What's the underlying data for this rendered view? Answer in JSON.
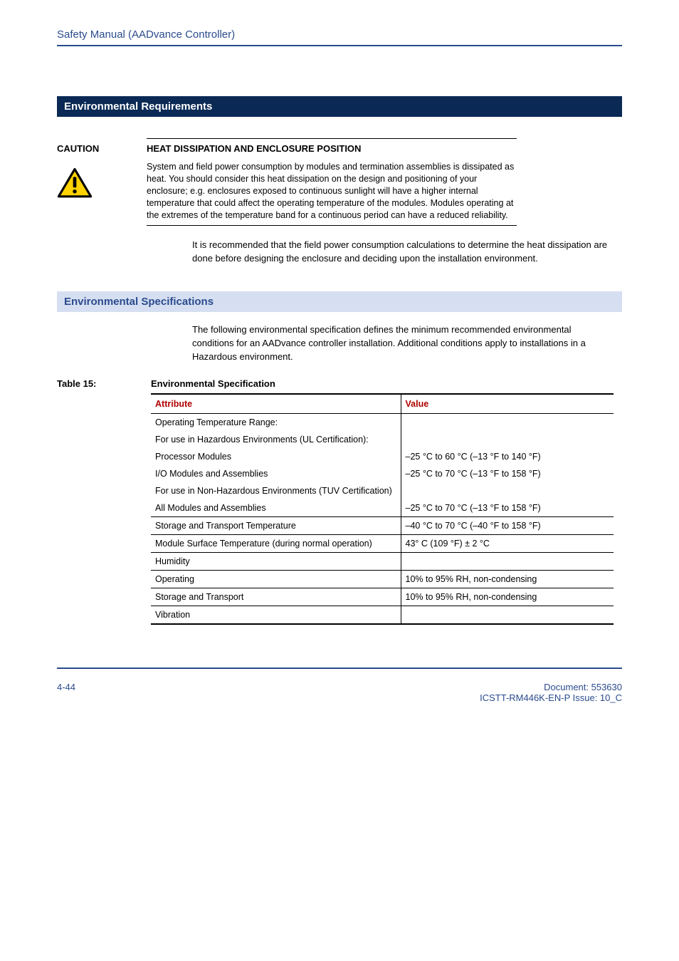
{
  "header": {
    "title": "Safety Manual (AADvance Controller)"
  },
  "sections": {
    "env_req_heading": "Environmental Requirements",
    "env_spec_heading": "Environmental Specifications"
  },
  "caution": {
    "label": "CAUTION",
    "heading": "HEAT DISSIPATION AND ENCLOSURE POSITION",
    "body": "System and field power consumption by modules and termination assemblies is dissipated as heat. You should consider this heat dissipation on the design and positioning of your enclosure; e.g. enclosures exposed to continuous sunlight will have a higher internal temperature that could affect the operating temperature of the modules.  Modules operating at the extremes of the temperature band for a continuous period can have a reduced reliability.",
    "icon_name": "caution-triangle-icon"
  },
  "recommendation_para": "It is recommended that the field power consumption calculations to determine the heat dissipation are done before designing the enclosure and deciding upon the installation environment.",
  "env_spec_intro": "The following environmental specification defines the minimum recommended environmental conditions for an AADvance controller installation. Additional conditions apply to installations in a Hazardous environment.",
  "table": {
    "label": "Table 15:",
    "caption": "Environmental Specification",
    "header_attr": "Attribute",
    "header_val": "Value",
    "rows": [
      {
        "attr": "Operating Temperature Range:",
        "val": "",
        "indent": 0,
        "divider": false
      },
      {
        "attr": "For use in Hazardous Environments (UL Certification):",
        "val": "",
        "indent": 0,
        "divider": false
      },
      {
        "attr": "Processor Modules",
        "val": "–25 °C to 60 °C (–13 °F to 140 °F)",
        "indent": 2,
        "divider": false
      },
      {
        "attr": "I/O Modules and Assemblies",
        "val": "–25 °C to 70 °C (–13 °F to 158 °F)",
        "indent": 2,
        "divider": false
      },
      {
        "attr": "For use in Non-Hazardous Environments (TUV Certification)",
        "val": "",
        "indent": 0,
        "divider": false
      },
      {
        "attr": "All Modules and Assemblies",
        "val": "–25 °C to 70 °C (–13 °F to 158 °F)",
        "indent": 2,
        "divider": true
      },
      {
        "attr": "Storage and Transport Temperature",
        "val": "–40 °C to 70 °C (–40 °F to 158 °F)",
        "indent": 2,
        "divider": true
      },
      {
        "attr": "Module Surface Temperature (during normal operation)",
        "val": "43° C (109 °F) ± 2 °C",
        "indent": 0,
        "divider": true
      },
      {
        "attr": "Humidity",
        "val": "",
        "indent": 0,
        "divider": true
      },
      {
        "attr": "Operating",
        "val": "10% to 95% RH, non-condensing",
        "indent": 2,
        "divider": true
      },
      {
        "attr": "Storage and Transport",
        "val": "10% to 95% RH, non-condensing",
        "indent": 2,
        "divider": true
      },
      {
        "attr": "Vibration",
        "val": "",
        "indent": 0,
        "divider": true,
        "last": true
      }
    ]
  },
  "footer": {
    "page": "4-44",
    "doc_line": "Document: 553630",
    "issue_line": "ICSTT-RM446K-EN-P Issue: 10_C"
  }
}
